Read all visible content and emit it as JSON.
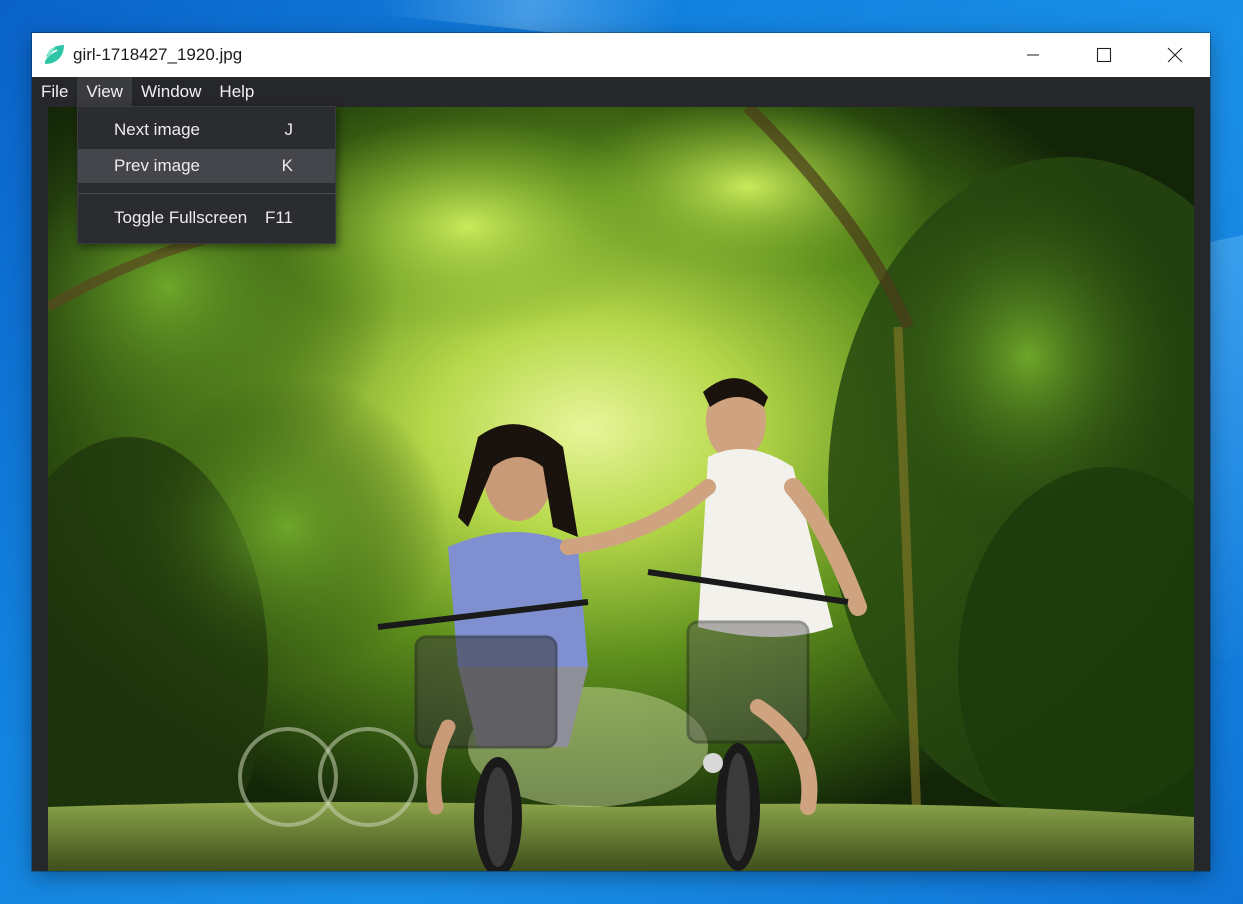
{
  "window": {
    "title": "girl-1718427_1920.jpg",
    "icon": "leaf-icon",
    "controls": [
      "minimize-icon",
      "maximize-icon",
      "close-icon"
    ]
  },
  "menubar": {
    "items": [
      {
        "label": "File"
      },
      {
        "label": "View"
      },
      {
        "label": "Window"
      },
      {
        "label": "Help"
      }
    ]
  },
  "view_menu": {
    "items": [
      {
        "label": "Next image",
        "shortcut": "J"
      },
      {
        "label": "Prev image",
        "shortcut": "K"
      },
      {
        "label": "Toggle Fullscreen",
        "shortcut": "F11"
      }
    ]
  },
  "colors": {
    "accent": "#2ec4a6",
    "window_bg": "#26272b",
    "menu_bg": "#2b2c30",
    "menu_hover": "#45464b"
  }
}
